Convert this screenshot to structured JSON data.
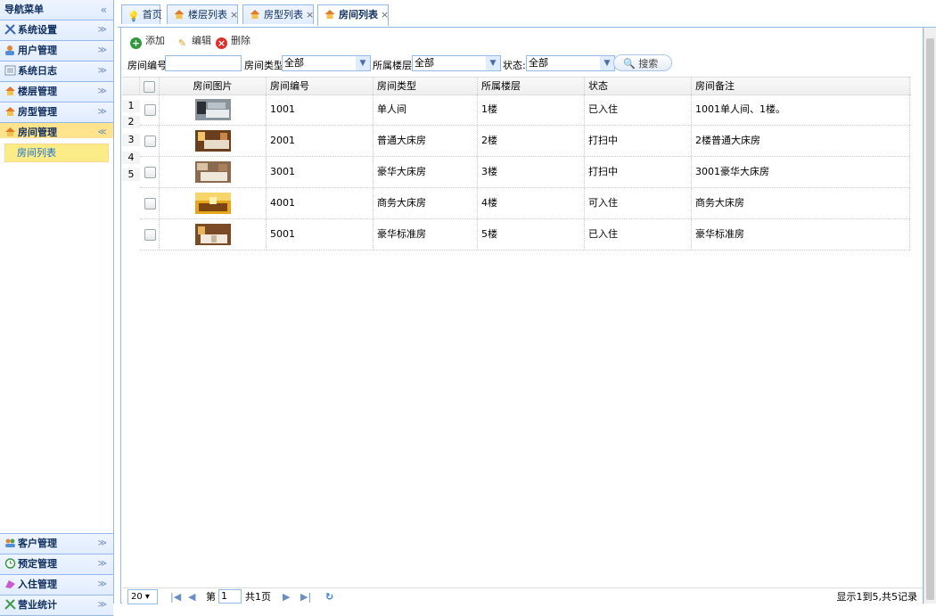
{
  "sidebar": {
    "title": "导航菜单",
    "collapse_icon": "double-chevron-left-icon",
    "sections": [
      {
        "label": "系统设置",
        "icon": "tools-icon"
      },
      {
        "label": "用户管理",
        "icon": "users-icon"
      },
      {
        "label": "系统日志",
        "icon": "log-icon"
      },
      {
        "label": "楼层管理",
        "icon": "house-icon"
      },
      {
        "label": "房型管理",
        "icon": "house-icon"
      },
      {
        "label": "房间管理",
        "icon": "house-icon",
        "active": true
      }
    ],
    "active_sub_item": "房间列表",
    "bottom_sections": [
      {
        "label": "客户管理",
        "icon": "customers-icon"
      },
      {
        "label": "预定管理",
        "icon": "reserve-icon"
      },
      {
        "label": "入住管理",
        "icon": "checkin-icon"
      },
      {
        "label": "营业统计",
        "icon": "stats-icon"
      }
    ]
  },
  "tabs": [
    {
      "label": "首页",
      "icon": "bulb-icon",
      "closable": false
    },
    {
      "label": "楼层列表",
      "icon": "house-icon",
      "closable": true
    },
    {
      "label": "房型列表",
      "icon": "house-icon",
      "closable": true
    },
    {
      "label": "房间列表",
      "icon": "house-icon",
      "closable": true,
      "active": true
    }
  ],
  "toolbar": {
    "add_label": "添加",
    "edit_label": "编辑",
    "delete_label": "删除"
  },
  "search": {
    "room_no_label": "房间编号:",
    "room_no_value": "",
    "room_type_label": "房间类型:",
    "room_type_value": "全部",
    "floor_label": "所属楼层:",
    "floor_value": "全部",
    "status_label": "状态:",
    "status_value": "全部",
    "search_button": "搜索"
  },
  "grid": {
    "columns": [
      "房间图片",
      "房间编号",
      "房间类型",
      "所属楼层",
      "状态",
      "房间备注"
    ],
    "row_numbers": [
      "1",
      "2",
      "3",
      "4",
      "5"
    ],
    "rows": [
      {
        "room_no": "1001",
        "type": "单人间",
        "floor": "1楼",
        "status": "已入住",
        "note": "1001单人间、1楼。"
      },
      {
        "room_no": "2001",
        "type": "普通大床房",
        "floor": "2楼",
        "status": "打扫中",
        "note": "2楼普通大床房"
      },
      {
        "room_no": "3001",
        "type": "豪华大床房",
        "floor": "3楼",
        "status": "打扫中",
        "note": "3001豪华大床房"
      },
      {
        "room_no": "4001",
        "type": "商务大床房",
        "floor": "4楼",
        "status": "可入住",
        "note": "商务大床房"
      },
      {
        "room_no": "5001",
        "type": "豪华标准房",
        "floor": "5楼",
        "status": "已入住",
        "note": "豪华标准房"
      }
    ]
  },
  "pager": {
    "page_size": "20",
    "page_prefix": "第",
    "current_page": "1",
    "total_pages": "共1页",
    "summary": "显示1到5,共5记录"
  },
  "colors": {
    "border": "#95b8e7",
    "header_gradient_top": "#eff5ff",
    "header_gradient_bottom": "#e0ecff",
    "active_section": "#ffe48d",
    "sub_item": "#fbec88"
  }
}
